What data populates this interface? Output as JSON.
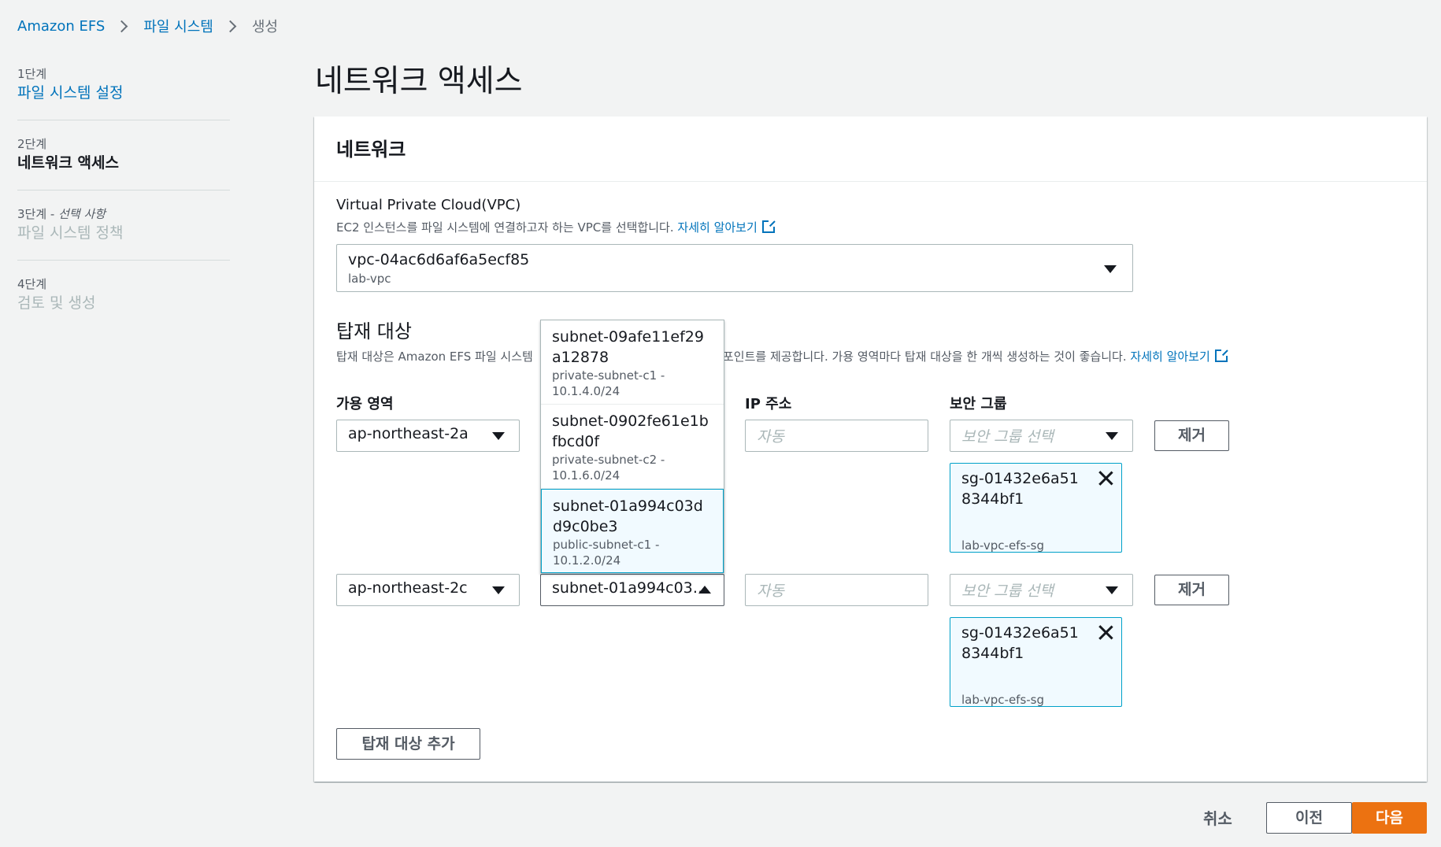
{
  "breadcrumb": {
    "items": [
      "Amazon EFS",
      "파일 시스템"
    ],
    "current": "생성"
  },
  "steps": [
    {
      "num": "1단계",
      "title": "파일 시스템 설정"
    },
    {
      "num": "2단계",
      "title": "네트워크 액세스"
    },
    {
      "num": "3단계",
      "optional": "선택 사항",
      "title": "파일 시스템 정책"
    },
    {
      "num": "4단계",
      "title": "검토 및 생성"
    }
  ],
  "page_title": "네트워크 액세스",
  "panel": {
    "title": "네트워크",
    "vpc": {
      "label": "Virtual Private Cloud(VPC)",
      "desc": "EC2 인스턴스를 파일 시스템에 연결하고자 하는 VPC를 선택합니다.",
      "learn_more": "자세히 알아보기",
      "value": "vpc-04ac6d6af6a5ecf85",
      "value_sub": "lab-vpc"
    },
    "mount": {
      "title": "탑재 대상",
      "desc_start": "탑재 대상은 Amazon EFS 파일 시스템",
      "desc_end": "포인트를 제공합니다. 가용 영역마다 탑재 대상을 한 개씩 생성하는 것이 좋습니다.",
      "learn_more": "자세히 알아보기",
      "col_az": "가용 영역",
      "col_ip": "IP 주소",
      "col_sg": "보안 그룹",
      "ip_placeholder": "자동",
      "sg_placeholder": "보안 그룹 선택",
      "remove": "제거",
      "add": "탑재 대상 추가",
      "rows": [
        {
          "az": "ap-northeast-2a",
          "sg_id": "sg-01432e6a518344bf1",
          "sg_name": "lab-vpc-efs-sg"
        },
        {
          "az": "ap-northeast-2c",
          "subnet": "subnet-01a994c03…",
          "sg_id": "sg-01432e6a518344bf1",
          "sg_name": "lab-vpc-efs-sg"
        }
      ],
      "subnet_options": [
        {
          "id": "subnet-09afe11ef29a12878",
          "name": "private-subnet-c1 - 10.1.4.0/24"
        },
        {
          "id": "subnet-0902fe61e1bfbcd0f",
          "name": "private-subnet-c2 - 10.1.6.0/24"
        },
        {
          "id": "subnet-01a994c03dd9c0be3",
          "name": "public-subnet-c1 - 10.1.2.0/24"
        }
      ]
    }
  },
  "footer": {
    "cancel": "취소",
    "previous": "이전",
    "next": "다음"
  }
}
